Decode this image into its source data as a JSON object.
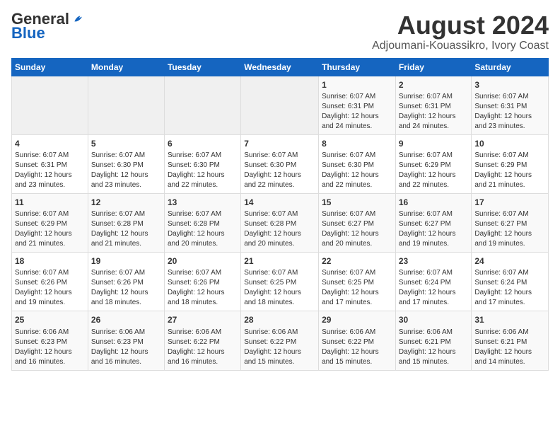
{
  "logo": {
    "general": "General",
    "blue": "Blue"
  },
  "title": {
    "month_year": "August 2024",
    "location": "Adjoumani-Kouassikro, Ivory Coast"
  },
  "calendar": {
    "headers": [
      "Sunday",
      "Monday",
      "Tuesday",
      "Wednesday",
      "Thursday",
      "Friday",
      "Saturday"
    ],
    "weeks": [
      [
        {
          "day": "",
          "info": ""
        },
        {
          "day": "",
          "info": ""
        },
        {
          "day": "",
          "info": ""
        },
        {
          "day": "",
          "info": ""
        },
        {
          "day": "1",
          "info": "Sunrise: 6:07 AM\nSunset: 6:31 PM\nDaylight: 12 hours\nand 24 minutes."
        },
        {
          "day": "2",
          "info": "Sunrise: 6:07 AM\nSunset: 6:31 PM\nDaylight: 12 hours\nand 24 minutes."
        },
        {
          "day": "3",
          "info": "Sunrise: 6:07 AM\nSunset: 6:31 PM\nDaylight: 12 hours\nand 23 minutes."
        }
      ],
      [
        {
          "day": "4",
          "info": "Sunrise: 6:07 AM\nSunset: 6:31 PM\nDaylight: 12 hours\nand 23 minutes."
        },
        {
          "day": "5",
          "info": "Sunrise: 6:07 AM\nSunset: 6:30 PM\nDaylight: 12 hours\nand 23 minutes."
        },
        {
          "day": "6",
          "info": "Sunrise: 6:07 AM\nSunset: 6:30 PM\nDaylight: 12 hours\nand 22 minutes."
        },
        {
          "day": "7",
          "info": "Sunrise: 6:07 AM\nSunset: 6:30 PM\nDaylight: 12 hours\nand 22 minutes."
        },
        {
          "day": "8",
          "info": "Sunrise: 6:07 AM\nSunset: 6:30 PM\nDaylight: 12 hours\nand 22 minutes."
        },
        {
          "day": "9",
          "info": "Sunrise: 6:07 AM\nSunset: 6:29 PM\nDaylight: 12 hours\nand 22 minutes."
        },
        {
          "day": "10",
          "info": "Sunrise: 6:07 AM\nSunset: 6:29 PM\nDaylight: 12 hours\nand 21 minutes."
        }
      ],
      [
        {
          "day": "11",
          "info": "Sunrise: 6:07 AM\nSunset: 6:29 PM\nDaylight: 12 hours\nand 21 minutes."
        },
        {
          "day": "12",
          "info": "Sunrise: 6:07 AM\nSunset: 6:28 PM\nDaylight: 12 hours\nand 21 minutes."
        },
        {
          "day": "13",
          "info": "Sunrise: 6:07 AM\nSunset: 6:28 PM\nDaylight: 12 hours\nand 20 minutes."
        },
        {
          "day": "14",
          "info": "Sunrise: 6:07 AM\nSunset: 6:28 PM\nDaylight: 12 hours\nand 20 minutes."
        },
        {
          "day": "15",
          "info": "Sunrise: 6:07 AM\nSunset: 6:27 PM\nDaylight: 12 hours\nand 20 minutes."
        },
        {
          "day": "16",
          "info": "Sunrise: 6:07 AM\nSunset: 6:27 PM\nDaylight: 12 hours\nand 19 minutes."
        },
        {
          "day": "17",
          "info": "Sunrise: 6:07 AM\nSunset: 6:27 PM\nDaylight: 12 hours\nand 19 minutes."
        }
      ],
      [
        {
          "day": "18",
          "info": "Sunrise: 6:07 AM\nSunset: 6:26 PM\nDaylight: 12 hours\nand 19 minutes."
        },
        {
          "day": "19",
          "info": "Sunrise: 6:07 AM\nSunset: 6:26 PM\nDaylight: 12 hours\nand 18 minutes."
        },
        {
          "day": "20",
          "info": "Sunrise: 6:07 AM\nSunset: 6:26 PM\nDaylight: 12 hours\nand 18 minutes."
        },
        {
          "day": "21",
          "info": "Sunrise: 6:07 AM\nSunset: 6:25 PM\nDaylight: 12 hours\nand 18 minutes."
        },
        {
          "day": "22",
          "info": "Sunrise: 6:07 AM\nSunset: 6:25 PM\nDaylight: 12 hours\nand 17 minutes."
        },
        {
          "day": "23",
          "info": "Sunrise: 6:07 AM\nSunset: 6:24 PM\nDaylight: 12 hours\nand 17 minutes."
        },
        {
          "day": "24",
          "info": "Sunrise: 6:07 AM\nSunset: 6:24 PM\nDaylight: 12 hours\nand 17 minutes."
        }
      ],
      [
        {
          "day": "25",
          "info": "Sunrise: 6:06 AM\nSunset: 6:23 PM\nDaylight: 12 hours\nand 16 minutes."
        },
        {
          "day": "26",
          "info": "Sunrise: 6:06 AM\nSunset: 6:23 PM\nDaylight: 12 hours\nand 16 minutes."
        },
        {
          "day": "27",
          "info": "Sunrise: 6:06 AM\nSunset: 6:22 PM\nDaylight: 12 hours\nand 16 minutes."
        },
        {
          "day": "28",
          "info": "Sunrise: 6:06 AM\nSunset: 6:22 PM\nDaylight: 12 hours\nand 15 minutes."
        },
        {
          "day": "29",
          "info": "Sunrise: 6:06 AM\nSunset: 6:22 PM\nDaylight: 12 hours\nand 15 minutes."
        },
        {
          "day": "30",
          "info": "Sunrise: 6:06 AM\nSunset: 6:21 PM\nDaylight: 12 hours\nand 15 minutes."
        },
        {
          "day": "31",
          "info": "Sunrise: 6:06 AM\nSunset: 6:21 PM\nDaylight: 12 hours\nand 14 minutes."
        }
      ]
    ]
  }
}
